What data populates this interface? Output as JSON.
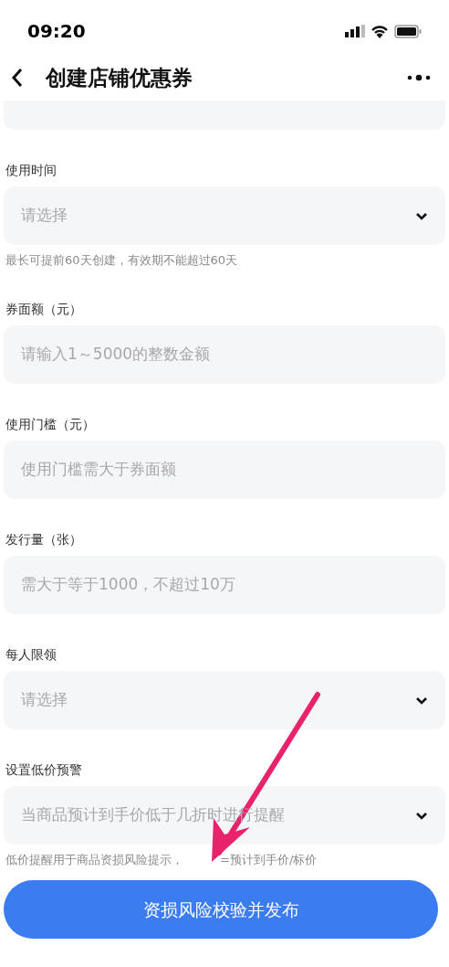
{
  "status_bar": {
    "time": "09:20"
  },
  "nav": {
    "title": "创建店铺优惠券"
  },
  "fields": [
    {
      "label": "使用时间",
      "kind": "select",
      "placeholder": "请选择",
      "hint": [
        "最长可提前60天创建，有效期不能超过60天"
      ]
    },
    {
      "label": "券面额（元）",
      "kind": "input",
      "placeholder": "请输入1～5000的整数金额"
    },
    {
      "label": "使用门槛（元）",
      "kind": "input",
      "placeholder": "使用门槛需大于券面额"
    },
    {
      "label": "发行量（张）",
      "kind": "input",
      "placeholder": "需大于等于1000，不超过10万"
    },
    {
      "label": "每人限领",
      "kind": "select",
      "placeholder": "请选择"
    },
    {
      "label": "设置低价预警",
      "kind": "select",
      "placeholder": "当商品预计到手价低于几折时进行提醒",
      "hint": [
        "低价提醒用于商品资损风险提示，",
        "=预计到手价/标价"
      ]
    }
  ],
  "submit": {
    "label": "资损风险校验并发布"
  }
}
